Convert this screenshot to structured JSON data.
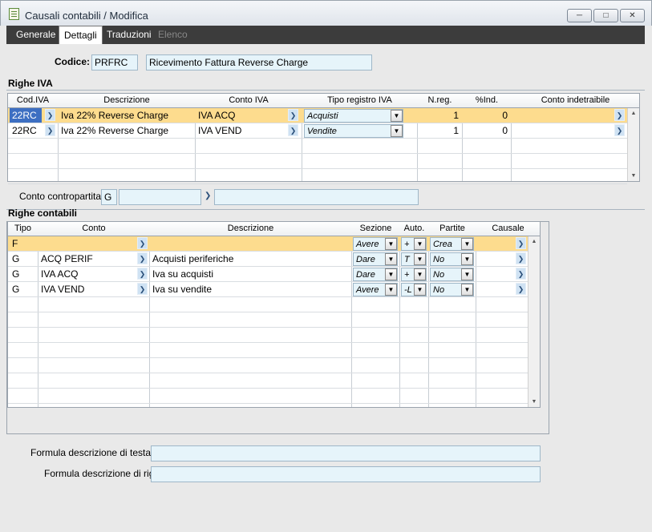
{
  "window": {
    "title": "Causali contabili / Modifica"
  },
  "tabs": [
    {
      "label": "Generale"
    },
    {
      "label": "Dettagli"
    },
    {
      "label": "Traduzioni"
    },
    {
      "label": "Elenco"
    }
  ],
  "header": {
    "codice_label": "Codice:",
    "codice_value": "PRFRC",
    "descrizione_value": "Ricevimento Fattura Reverse Charge"
  },
  "righe_iva": {
    "section_title": "Righe IVA",
    "columns": [
      "Cod.IVA",
      "Descrizione",
      "Conto IVA",
      "Tipo registro IVA",
      "N.reg.",
      "%Ind.",
      "Conto indetraibile"
    ],
    "rows": [
      {
        "cod": "22RC",
        "descrizione": "Iva 22% Reverse Charge",
        "conto": "IVA ACQ",
        "tipo": "Acquisti",
        "nreg": "1",
        "ind": "0",
        "indetraibile": ""
      },
      {
        "cod": "22RC",
        "descrizione": "Iva 22% Reverse Charge",
        "conto": "IVA VEND",
        "tipo": "Vendite",
        "nreg": "1",
        "ind": "0",
        "indetraibile": ""
      }
    ]
  },
  "contropartita": {
    "label": "Conto contropartita:",
    "tipo": "G",
    "conto": "",
    "descrizione": ""
  },
  "righe_contabili": {
    "section_title": "Righe contabili",
    "columns": [
      "Tipo",
      "Conto",
      "Descrizione",
      "Sezione",
      "Auto.",
      "Partite",
      "Causale"
    ],
    "rows": [
      {
        "tipo": "F",
        "conto": "",
        "descrizione": "",
        "sezione": "Avere",
        "auto": "+",
        "partite": "Crea",
        "causale": ""
      },
      {
        "tipo": "G",
        "conto": "ACQ PERIF",
        "descrizione": "Acquisti periferiche",
        "sezione": "Dare",
        "auto": "T",
        "partite": "No",
        "causale": ""
      },
      {
        "tipo": "G",
        "conto": "IVA ACQ",
        "descrizione": "Iva su acquisti",
        "sezione": "Dare",
        "auto": "+",
        "partite": "No",
        "causale": ""
      },
      {
        "tipo": "G",
        "conto": "IVA VEND",
        "descrizione": "Iva su vendite",
        "sezione": "Avere",
        "auto": "-L",
        "partite": "No",
        "causale": ""
      }
    ]
  },
  "formula": {
    "testata_label": "Formula descrizione di testata:",
    "testata_value": "",
    "riga_label": "Formula descrizione di riga:",
    "riga_value": ""
  }
}
